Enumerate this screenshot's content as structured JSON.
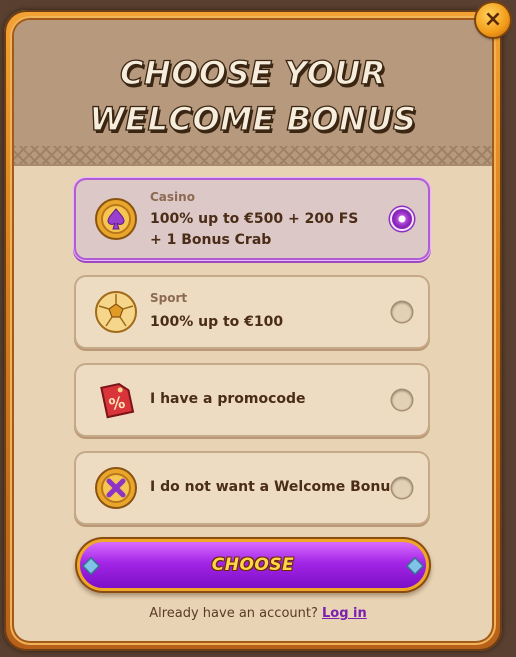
{
  "modal": {
    "title": "Choose your Welcome Bonus",
    "close_label": "×"
  },
  "options": [
    {
      "tag": "Casino",
      "label": "100% up to €500 + 200 FS + 1 Bonus Crab",
      "icon": "spade-coin-icon",
      "selected": true
    },
    {
      "tag": "Sport",
      "label": "100% up to €100",
      "icon": "soccer-ball-icon",
      "selected": false
    },
    {
      "tag": "",
      "label": "I have a promocode",
      "icon": "percent-tag-icon",
      "selected": false
    },
    {
      "tag": "",
      "label": "I do not want a Welcome Bonus",
      "icon": "x-coin-icon",
      "selected": false
    }
  ],
  "choose_button": {
    "label": "Choose"
  },
  "footer": {
    "text": "Already have an account?",
    "link": "Log in"
  },
  "colors": {
    "accent": "#a325e6",
    "gold": "#f0a829",
    "panel": "#e8d3b4"
  }
}
